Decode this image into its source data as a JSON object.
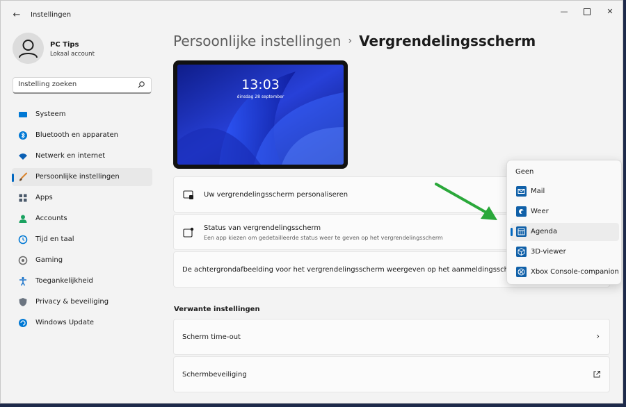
{
  "app": {
    "title": "Instellingen"
  },
  "window_controls": {
    "minimize": "—",
    "close": "✕"
  },
  "user": {
    "name": "PC Tips",
    "account": "Lokaal account"
  },
  "search": {
    "placeholder": "Instelling zoeken"
  },
  "sidebar": {
    "items": [
      {
        "label": "Systeem",
        "icon": "monitor-icon",
        "color": "#0078d4"
      },
      {
        "label": "Bluetooth en apparaten",
        "icon": "bluetooth-icon",
        "color": "#0078d4"
      },
      {
        "label": "Netwerk en internet",
        "icon": "wifi-icon",
        "color": "#0a5fb4"
      },
      {
        "label": "Persoonlijke instellingen",
        "icon": "brush-icon",
        "color": "#d9822b",
        "active": true
      },
      {
        "label": "Apps",
        "icon": "apps-icon",
        "color": "#4b5a6b"
      },
      {
        "label": "Accounts",
        "icon": "person-icon",
        "color": "#1aa260"
      },
      {
        "label": "Tijd en taal",
        "icon": "clock-globe-icon",
        "color": "#0078d4"
      },
      {
        "label": "Gaming",
        "icon": "gamepad-icon",
        "color": "#6b6b6b"
      },
      {
        "label": "Toegankelijkheid",
        "icon": "accessibility-icon",
        "color": "#1a73c9"
      },
      {
        "label": "Privacy & beveiliging",
        "icon": "shield-icon",
        "color": "#6b7480"
      },
      {
        "label": "Windows Update",
        "icon": "update-icon",
        "color": "#0078d4"
      }
    ]
  },
  "breadcrumb": {
    "parent": "Persoonlijke instellingen",
    "separator": "›",
    "current": "Vergrendelingsscherm"
  },
  "preview": {
    "time": "13:03",
    "date": "dinsdag 28 september"
  },
  "settings": {
    "personalize": {
      "title": "Uw vergrendelingsscherm personaliseren"
    },
    "status": {
      "title": "Status van vergrendelingsscherm",
      "subtitle": "Een app kiezen om gedetailleerde status weer te geven op het vergrendelingsscherm"
    },
    "background": {
      "title": "De achtergrondafbeelding voor het vergrendelingsscherm weergeven op het aanmeldingsscherm"
    }
  },
  "related": {
    "heading": "Verwante instellingen",
    "items": [
      {
        "label": "Scherm time-out",
        "icon": "chevron-right-icon",
        "glyph": "›"
      },
      {
        "label": "Schermbeveiliging",
        "icon": "external-link-icon"
      }
    ]
  },
  "dropdown": {
    "options": [
      {
        "label": "Geen"
      },
      {
        "label": "Mail",
        "icon": "mail-icon"
      },
      {
        "label": "Weer",
        "icon": "weather-icon"
      },
      {
        "label": "Agenda",
        "icon": "calendar-icon",
        "selected": true
      },
      {
        "label": "3D-viewer",
        "icon": "cube-icon"
      },
      {
        "label": "Xbox Console-companion",
        "icon": "xbox-icon"
      }
    ]
  },
  "colors": {
    "accent": "#0067c0",
    "annotation_arrow": "#2aa83a"
  }
}
